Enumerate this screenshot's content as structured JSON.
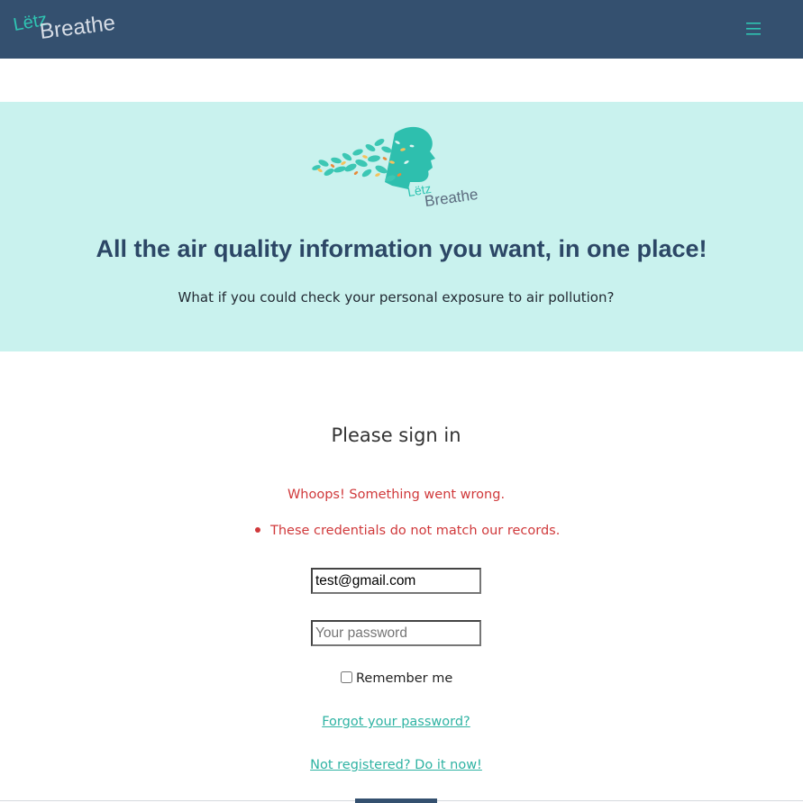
{
  "navbar": {
    "logo": {
      "word1": "Lëtz",
      "word2": "Breathe"
    },
    "menu_icon": "hamburger-menu-icon",
    "background": "#34506f",
    "accent": "#2fc4b2"
  },
  "hero": {
    "logo": {
      "word1": "Lëtz",
      "word2": "Breathe"
    },
    "title": "All the air quality information you want, in one place!",
    "subtitle": "What if you could check your personal exposure to air pollution?",
    "background": "#c9f2ee"
  },
  "login": {
    "heading": "Please sign in",
    "error_title": "Whoops! Something went wrong.",
    "errors": [
      "These credentials do not match our records."
    ],
    "email_value": "test@gmail.com",
    "password_placeholder": "Your password",
    "remember_label": "Remember me",
    "remember_checked": false,
    "forgot_link": "Forgot your password?",
    "register_link": "Not registered? Do it now!",
    "error_color": "#d0393b",
    "link_color": "#2fb3a3"
  }
}
